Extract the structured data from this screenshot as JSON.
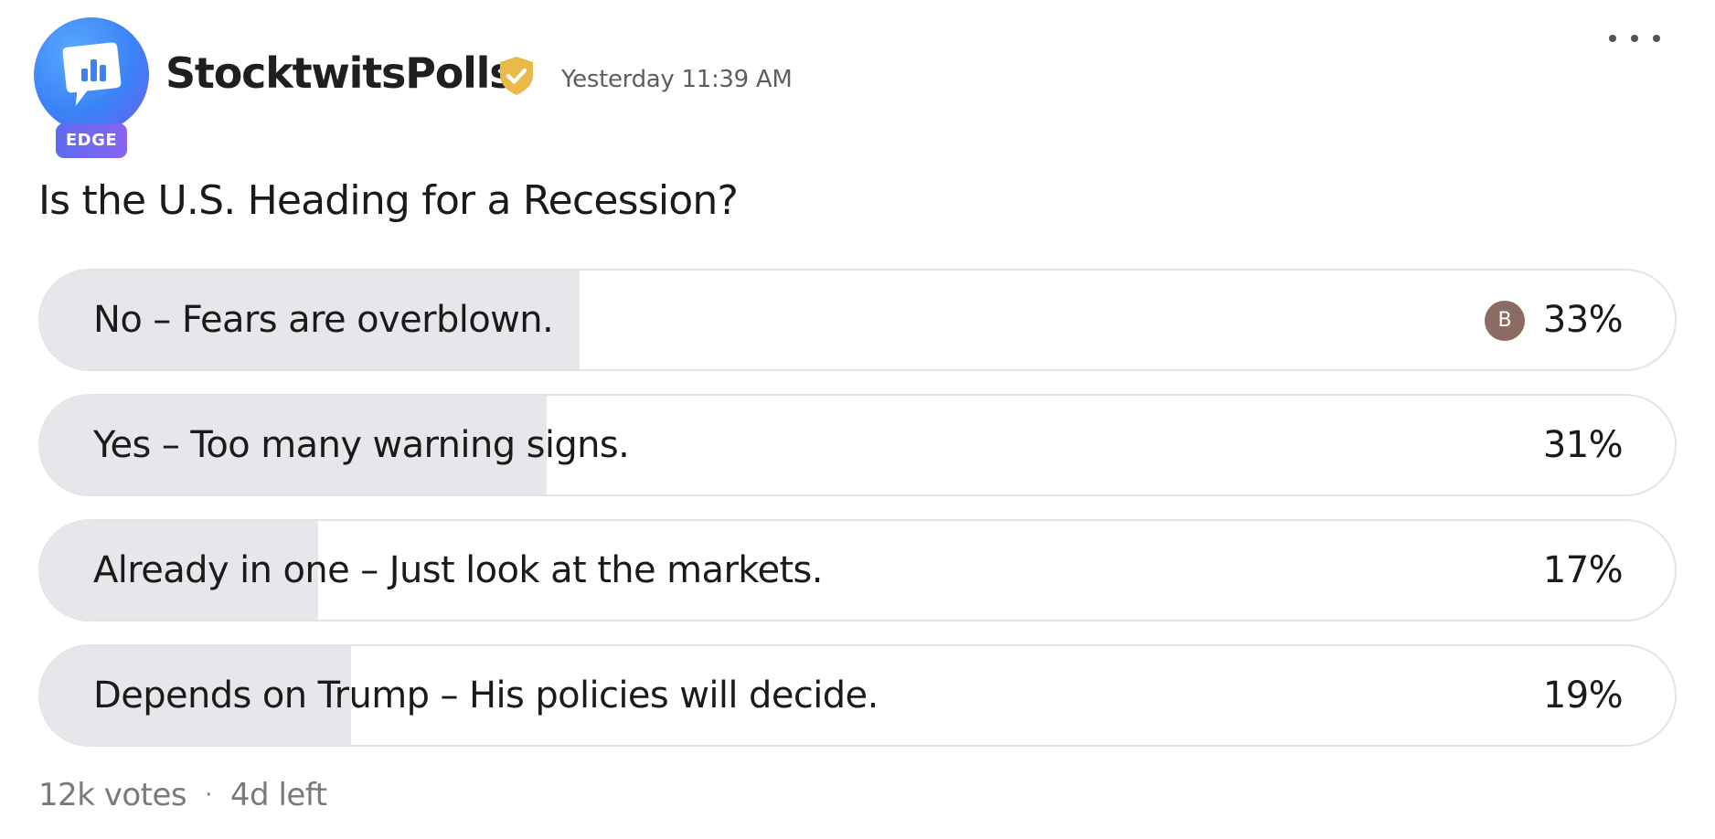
{
  "post": {
    "author": "StocktwitsPolls",
    "badge": "EDGE",
    "timestamp": "Yesterday 11:39 AM",
    "avatar_icon": "chart-bubble-icon",
    "verified_icon": "verified-shield-icon",
    "menu_icon": "more-dots-icon"
  },
  "poll": {
    "question": "Is the U.S. Heading for a Recession?",
    "options": [
      {
        "label": "No – Fears are overblown.",
        "percent_text": "33%",
        "share": 0.33,
        "voter_initial": "B"
      },
      {
        "label": "Yes – Too many warning signs.",
        "percent_text": "31%",
        "share": 0.31
      },
      {
        "label": "Already in one – Just look at the markets.",
        "percent_text": "17%",
        "share": 0.17
      },
      {
        "label": "Depends on Trump – His policies will decide.",
        "percent_text": "19%",
        "share": 0.19
      }
    ],
    "votes": "12k votes",
    "separator": "·",
    "time_left": "4d left"
  },
  "colors": {
    "bar_fill": "#e7e7eb",
    "verified": "#e9b949",
    "avatar_blue": "#3b82f6",
    "badge_purple": "#7a66f0",
    "voter_avatar": "#8a6c63"
  }
}
